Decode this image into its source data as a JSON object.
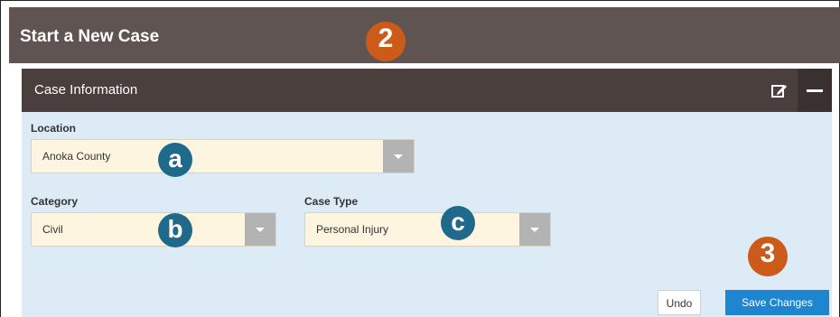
{
  "page": {
    "title": "Start a New Case"
  },
  "panel": {
    "title": "Case Information"
  },
  "fields": {
    "location": {
      "label": "Location",
      "value": "Anoka County"
    },
    "category": {
      "label": "Category",
      "value": "Civil"
    },
    "case_type": {
      "label": "Case Type",
      "value": "Personal Injury"
    }
  },
  "badges": {
    "step2": "2",
    "step3": "3",
    "a": "a",
    "b": "b",
    "c": "c"
  },
  "buttons": {
    "undo": "Undo",
    "save": "Save Changes"
  },
  "colors": {
    "header": "#5f5452",
    "panel_header": "#4b3f3d",
    "panel_bg": "#dcebf5",
    "field_bg": "#fdf5e0",
    "save": "#1e86d0",
    "badge_blue": "#1f6a8a",
    "badge_orange": "#cc5a19"
  },
  "icons": {
    "edit": "edit-icon",
    "collapse": "minus-icon",
    "dropdown": "chevron-down-icon"
  }
}
